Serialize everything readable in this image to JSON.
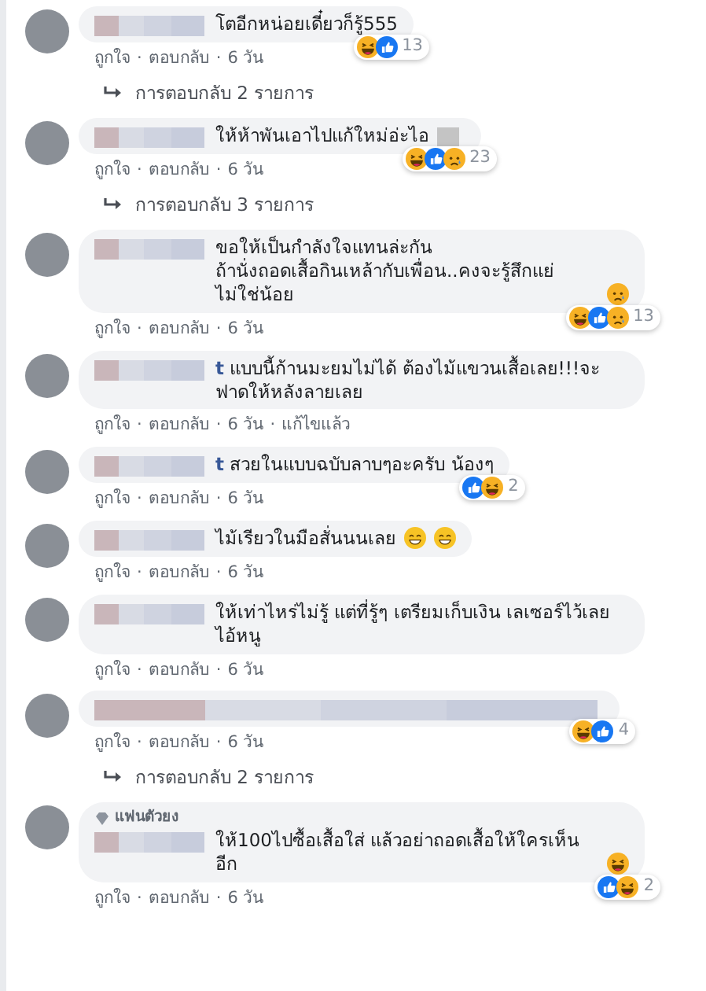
{
  "separator": "·",
  "comments": [
    {
      "text": "โตอีกหน่อยเดี๋ยวก็รู้555",
      "reactions": {
        "icons": [
          {
            "kind": "haha"
          },
          {
            "kind": "like"
          }
        ],
        "count": "13"
      },
      "actions": [
        "ถูกใจ",
        "ตอบกลับ"
      ],
      "time": "6 วัน",
      "replies": "การตอบกลับ 2 รายการ"
    },
    {
      "text": "ให้ห้าพันเอาไปแก้ใหม่อ่ะไอ",
      "trailing_redaction": true,
      "reactions": {
        "icons": [
          {
            "kind": "haha"
          },
          {
            "kind": "like"
          },
          {
            "kind": "sad"
          }
        ],
        "count": "23"
      },
      "actions": [
        "ถูกใจ",
        "ตอบกลับ"
      ],
      "time": "6 วัน",
      "replies": "การตอบกลับ 3 รายการ"
    },
    {
      "text": "ขอให้เป็นกำลังใจแทนล่ะกัน\nถ้านั่งถอดเสื้อกินเหล้ากับเพื่อน..คงจะรู้สึกแย่ ไม่ใช่น้อย",
      "emoji": [
        {
          "kind": "sad"
        }
      ],
      "reactions": {
        "icons": [
          {
            "kind": "haha"
          },
          {
            "kind": "like"
          },
          {
            "kind": "sad"
          }
        ],
        "count": "13"
      },
      "actions": [
        "ถูกใจ",
        "ตอบกลับ"
      ],
      "time": "6 วัน"
    },
    {
      "text": "**t** แบบนี้ก้านมะยมไม่ได้ ต้องไม้แขวนเสื้อเลย!!!จะฟาดให้หลังลายเลย",
      "actions": [
        "ถูกใจ",
        "ตอบกลับ"
      ],
      "time": "6 วัน",
      "edited": "แก้ไขแล้ว"
    },
    {
      "text": "**t** สวยในแบบฉบับลาบๆอะครับ น้องๆ",
      "reactions": {
        "icons": [
          {
            "kind": "like"
          },
          {
            "kind": "haha"
          }
        ],
        "count": "2"
      },
      "actions": [
        "ถูกใจ",
        "ตอบกลับ"
      ],
      "time": "6 วัน"
    },
    {
      "text": "ไม้เรียวในมือสั่นนนเลย",
      "emoji": [
        {
          "kind": "grin"
        },
        {
          "kind": "grin"
        }
      ],
      "actions": [
        "ถูกใจ",
        "ตอบกลับ"
      ],
      "time": "6 วัน"
    },
    {
      "text": "ให้เท่าไหร่ไม่รู้ แต่ที่รู้ๆ เตรียมเก็บเงิน เลเซอร์ไว้เลยไอ้หนู",
      "actions": [
        "ถูกใจ",
        "ตอบกลับ"
      ],
      "time": "6 วัน"
    },
    {
      "reactions": {
        "icons": [
          {
            "kind": "haha"
          },
          {
            "kind": "like"
          }
        ],
        "count": "4"
      },
      "actions": [
        "ถูกใจ",
        "ตอบกลับ"
      ],
      "time": "6 วัน",
      "replies": "การตอบกลับ 2 รายการ"
    },
    {
      "badge": "แฟนตัวยง",
      "text": "ให้100ไปซื้อเสื้อใส่ แล้วอย่าถอดเสื้อให้ใครเห็นอีก",
      "emoji": [
        {
          "kind": "haha"
        }
      ],
      "reactions": {
        "icons": [
          {
            "kind": "like"
          },
          {
            "kind": "haha"
          }
        ],
        "count": "2"
      },
      "actions": [
        "ถูกใจ",
        "ตอบกลับ"
      ],
      "time": "6 วัน"
    }
  ]
}
